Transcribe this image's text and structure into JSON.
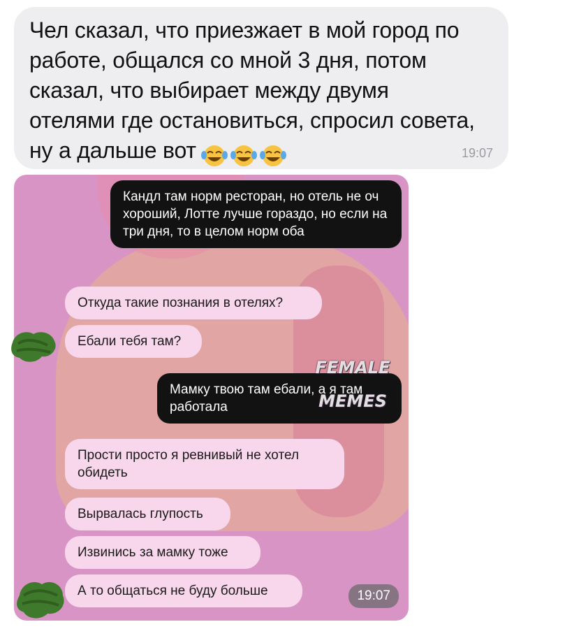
{
  "outer_message": {
    "text": "Чел сказал, что приезжает в мой город по работе, общался со мной 3 дня, потом сказал, что выбирает между двумя отелями где остановиться, спросил совета, ну а дальше вот",
    "emojis": [
      "joy-emoji",
      "joy-emoji",
      "joy-emoji"
    ],
    "time": "19:07"
  },
  "inner_chat": {
    "messages": [
      {
        "side": "right",
        "style": "dark",
        "text": "Кандл там норм ресторан, но отель не оч хороший, Лотте лучше гораздо, но если на три дня, то в целом норм оба"
      },
      {
        "side": "left",
        "style": "light",
        "text": "Откуда такие познания в отелях?"
      },
      {
        "side": "left",
        "style": "light",
        "text": "Ебали тебя там?"
      },
      {
        "side": "right",
        "style": "dark",
        "text": "Мамку твою там ебали, а я там работала"
      },
      {
        "side": "left",
        "style": "light",
        "text": "Прости просто я ревнивый не хотел обидеть"
      },
      {
        "side": "left",
        "style": "light",
        "text": "Вырвалась глупость"
      },
      {
        "side": "left",
        "style": "light",
        "text": "Извинись за мамку тоже"
      },
      {
        "side": "left",
        "style": "light",
        "text": "А то общаться не буду больше"
      }
    ],
    "time": "19:07",
    "watermark": [
      "FEMALE",
      "MEMES"
    ]
  },
  "colors": {
    "outer_bubble": "#eeeef0",
    "inner_background": "#d894c4",
    "dark_bubble": "#121212",
    "light_bubble": "#f8d6ec",
    "censor_blob": "#3f7a2c"
  }
}
